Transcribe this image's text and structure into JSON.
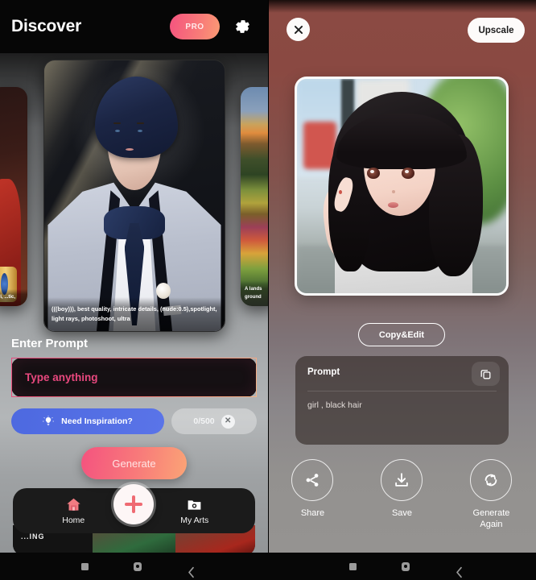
{
  "left_panel": {
    "header": {
      "title": "Discover",
      "pro_label": "PRO",
      "gear_icon": "gear-icon"
    },
    "carousel": {
      "cards": [
        {
          "caption": "...ri,\n...tic,",
          "alt": "warrior-thumbnail"
        },
        {
          "caption": "(((boy))), best quality, intricate details, (nude:0.5),spotlight, light rays, photoshoot, ultra",
          "alt": "boy-in-suit-artwork"
        },
        {
          "caption": "A lands\nground",
          "alt": "landscape-thumbnail"
        }
      ]
    },
    "prompt": {
      "section_label": "Enter Prompt",
      "placeholder": "Type anything",
      "value": "",
      "inspiration_label": "Need Inspiration?",
      "counter": "0/500",
      "clear_icon": "close-circle-icon",
      "bulb_icon": "lightbulb-icon"
    },
    "generate_label": "Generate",
    "bottom_nav": {
      "items": [
        {
          "label": "Home",
          "icon": "home-icon"
        },
        {
          "label": "My Arts",
          "icon": "folder-photo-icon"
        }
      ],
      "fab_icon": "plus-icon"
    },
    "bottom_strip_text": "...ING"
  },
  "right_panel": {
    "header": {
      "close_icon": "close-icon",
      "upscale_label": "Upscale"
    },
    "hero_image_alt": "generated-girl-black-hair",
    "copy_edit_label": "Copy&Edit",
    "prompt_card": {
      "title": "Prompt",
      "copy_icon": "copy-icon",
      "text": "girl  ,  black hair"
    },
    "actions": [
      {
        "label": "Share",
        "icon": "share-icon"
      },
      {
        "label": "Save",
        "icon": "download-icon"
      },
      {
        "label": "Generate\nAgain",
        "label_line1": "Generate",
        "label_line2": "Again",
        "icon": "refresh-icon"
      }
    ]
  },
  "system_nav": {
    "recents_icon": "square-recents-icon",
    "home_icon": "circle-home-icon",
    "back_icon": "back-chevron-icon"
  },
  "colors": {
    "accent_pink": "#e8487e",
    "accent_orange": "#fba476",
    "inspiration_blue": "#4d69e0",
    "right_bg_top": "#8b4a43",
    "right_bg_bottom": "#969492",
    "nav_dark": "#1b1b1b"
  }
}
